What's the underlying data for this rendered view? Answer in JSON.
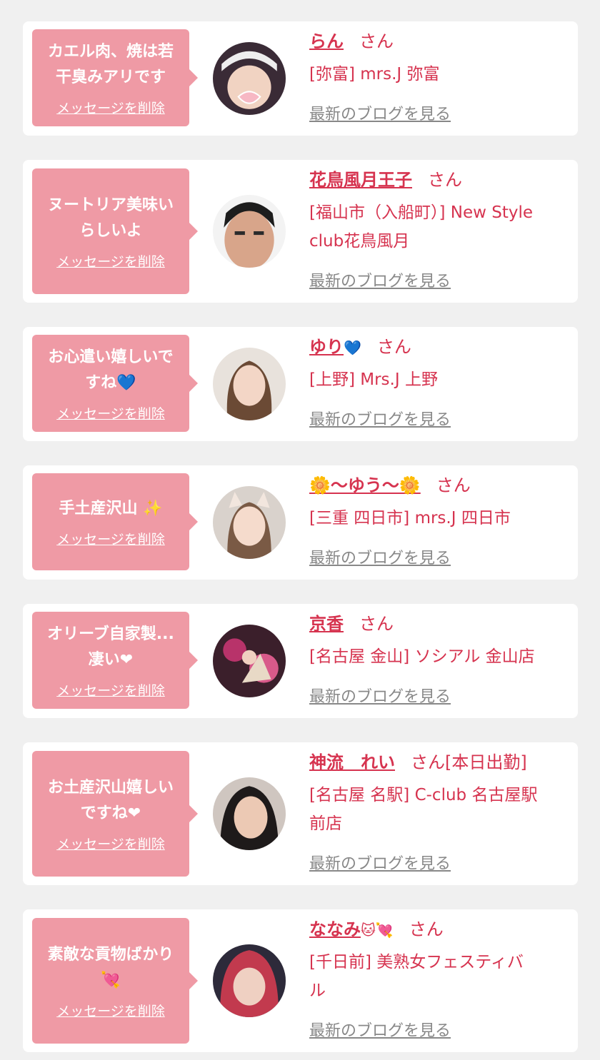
{
  "colors": {
    "background": "#f0f0f0",
    "card": "#ffffff",
    "bubble": "#ef9aa5",
    "accent": "#d6334f",
    "muted": "#888888"
  },
  "cards": [
    {
      "message_lines": [
        "カエル肉、焼は若",
        "干臭みアリです"
      ],
      "delete_label": "メッセージを削除",
      "name": "らん",
      "name_suffix": "",
      "honorific": "さん",
      "shop_lines": [
        "[弥富] mrs.J 弥富"
      ],
      "blog_label": "最新のブログを見る"
    },
    {
      "message_lines": [
        "ヌートリア美味い",
        "らしいよ"
      ],
      "delete_label": "メッセージを削除",
      "name": "花鳥風月王子",
      "name_suffix": "",
      "honorific": "さん",
      "shop_lines": [
        "[福山市（入船町）] New Style",
        "club花鳥風月"
      ],
      "blog_label": "最新のブログを見る"
    },
    {
      "message_lines": [
        "お心遣い嬉しいで",
        "すね💙"
      ],
      "delete_label": "メッセージを削除",
      "name": "ゆり",
      "name_suffix": "💙",
      "honorific": "さん",
      "shop_lines": [
        "[上野] Mrs.J 上野"
      ],
      "blog_label": "最新のブログを見る"
    },
    {
      "message_lines": [
        "手土産沢山 ✨"
      ],
      "delete_label": "メッセージを削除",
      "name": "🌼〜ゆう〜🌼",
      "name_suffix": "",
      "honorific": "さん",
      "shop_lines": [
        "[三重 四日市] mrs.J 四日市"
      ],
      "blog_label": "最新のブログを見る"
    },
    {
      "message_lines": [
        "オリーブ自家製...",
        "凄い❤"
      ],
      "delete_label": "メッセージを削除",
      "name": "京香",
      "name_suffix": "",
      "honorific": "さん",
      "shop_lines": [
        "[名古屋 金山] ソシアル 金山店"
      ],
      "blog_label": "最新のブログを見る"
    },
    {
      "message_lines": [
        "お土産沢山嬉しい",
        "ですね❤"
      ],
      "delete_label": "メッセージを削除",
      "name": "神流　れい",
      "name_suffix": "",
      "honorific": "さん[本日出勤]",
      "shop_lines": [
        "[名古屋 名駅] C-club 名古屋駅",
        "前店"
      ],
      "blog_label": "最新のブログを見る"
    },
    {
      "message_lines": [
        "素敵な貢物ばかり",
        "💘"
      ],
      "delete_label": "メッセージを削除",
      "name": "ななみ",
      "name_suffix": "🐱💘",
      "honorific": "さん",
      "shop_lines": [
        "[千日前] 美熟女フェスティバ",
        "ル"
      ],
      "blog_label": "最新のブログを見る"
    }
  ]
}
